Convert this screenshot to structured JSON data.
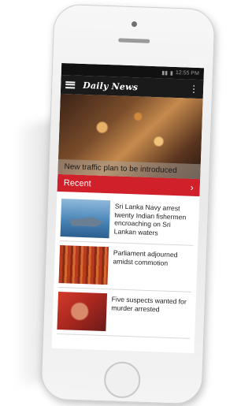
{
  "app": {
    "brand": "Daily News"
  },
  "status_bar": {
    "time": "12:55 PM"
  },
  "hero": {
    "title": "New traffic plan to be introduced"
  },
  "recent": {
    "label": "Recent"
  },
  "articles": [
    {
      "title": "Sri Lanka Navy arrest twenty Indian fishermen encroaching on Sri Lankan waters",
      "thumb": "navy"
    },
    {
      "title": "Parliament adjourned amidst commotion",
      "thumb": "parl"
    },
    {
      "title": "Five suspects wanted for murder arrested",
      "thumb": "suspects"
    }
  ],
  "colors": {
    "accent": "#d0212b",
    "appbar": "#1a1a1a"
  },
  "icons": {
    "menu": "menu-icon",
    "more": "more-vert-icon",
    "chevron": "chevron-right-icon"
  }
}
